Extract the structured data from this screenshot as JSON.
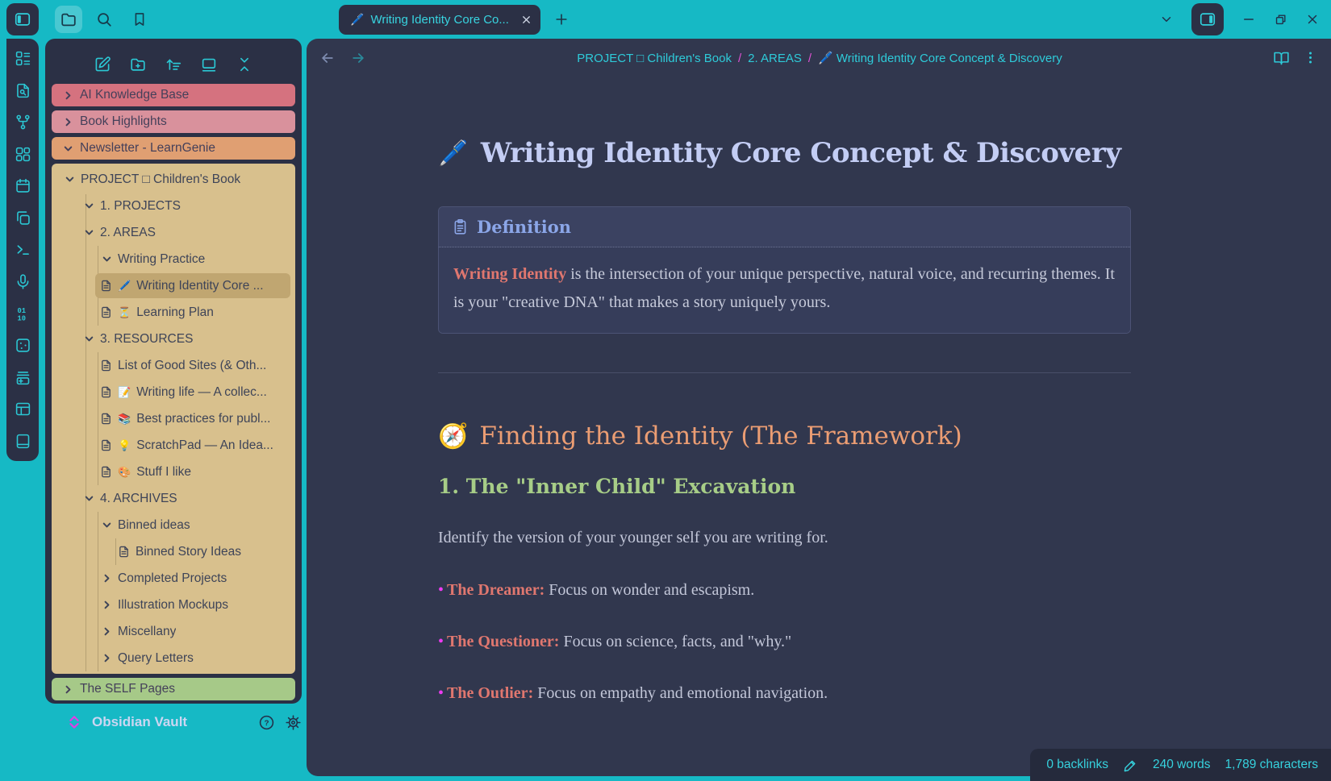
{
  "titlebar": {
    "tab": {
      "emoji": "🖊️",
      "title": "Writing Identity Core Co..."
    },
    "ribbon_icons": [
      "files",
      "search",
      "bookmarks"
    ],
    "window_icons": [
      "tab-list-chevron",
      "right-sidebar-toggle",
      "minimize",
      "restore",
      "close"
    ]
  },
  "rail_icons": [
    "workspace-list",
    "file-search",
    "graph-view",
    "canvas",
    "calendar",
    "duplicate",
    "terminal",
    "audio-recorder",
    "binary",
    "random-note",
    "add-card",
    "workspace-layout",
    "reading-book"
  ],
  "explorer": {
    "toolbar_icons": [
      "new-note",
      "new-folder",
      "sort-ascending",
      "stack-view",
      "collapse-all"
    ],
    "top": [
      {
        "label": "AI Knowledge Base"
      },
      {
        "label": "Book Highlights"
      },
      {
        "label": "Newsletter - LearnGenie"
      }
    ],
    "tree": [
      {
        "label": "PROJECT □ Children's Book"
      },
      {
        "label": "1. PROJECTS"
      },
      {
        "label": "2. AREAS"
      },
      {
        "label": "Writing Practice"
      },
      {
        "emoji": "🖊️",
        "label": "Writing Identity Core ..."
      },
      {
        "emoji": "⏳",
        "label": "Learning Plan"
      },
      {
        "label": "3. RESOURCES"
      },
      {
        "emoji": "",
        "label": "List of Good Sites (& Oth..."
      },
      {
        "emoji": "📝",
        "label": "Writing life — A collec..."
      },
      {
        "emoji": "📚",
        "label": "Best practices for publ..."
      },
      {
        "emoji": "💡",
        "label": "ScratchPad — An Idea..."
      },
      {
        "emoji": "🎨",
        "label": "Stuff I like"
      },
      {
        "label": "4. ARCHIVES"
      },
      {
        "label": "Binned ideas"
      },
      {
        "emoji": "",
        "label": "Binned Story Ideas"
      },
      {
        "label": "Completed Projects"
      },
      {
        "label": "Illustration Mockups"
      },
      {
        "label": "Miscellany"
      },
      {
        "label": "Query Letters"
      }
    ],
    "bottom": [
      {
        "label": "The SELF Pages"
      }
    ]
  },
  "vault": {
    "name": "Obsidian Vault"
  },
  "main": {
    "breadcrumb": [
      "PROJECT □ Children's Book",
      "2. AREAS",
      "🖊️ Writing Identity Core Concept & Discovery"
    ],
    "breadcrumb_separator": "/",
    "title": {
      "emoji": "🖊️",
      "text": "Writing Identity Core Concept & Discovery"
    },
    "callout": {
      "header": "Definition",
      "lead": "Writing Identity",
      "rest": " is the intersection of your unique perspective, natural voice, and recurring themes. It is your \"creative DNA\" that makes a story uniquely yours."
    },
    "h2": {
      "emoji": "🧭",
      "text": "Finding the Identity (The Framework)"
    },
    "h3": "1. The \"Inner Child\" Excavation",
    "paragraph": "Identify the version of your younger self you are writing for.",
    "bullets": [
      {
        "lead": "The Dreamer:",
        "rest": " Focus on wonder and escapism."
      },
      {
        "lead": "The Questioner:",
        "rest": " Focus on science, facts, and \"why.\""
      },
      {
        "lead": "The Outlier:",
        "rest": " Focus on empathy and emotional navigation."
      }
    ]
  },
  "statusbar": {
    "backlinks": "0 backlinks",
    "words": "240 words",
    "characters": "1,789 characters"
  },
  "colors": {
    "accent_teal": "#16b9c5",
    "panel_navy": "#2b3045",
    "pane_navy": "#31374e",
    "folder_red": "#d5727f",
    "folder_pink": "#d9919c",
    "folder_orange": "#e09f72",
    "folder_tan": "#d8c08d",
    "folder_green": "#a6c988",
    "selected_tan": "#c0a671",
    "cyan_text": "#38d4e0",
    "pink_separator": "#e052d4",
    "title_periwinkle": "#c3cdf4",
    "h2_orange": "#eb9d73",
    "h3_green": "#a7cd87",
    "salmon_bold": "#e0776f",
    "bullet_magenta": "#ee3bf2"
  }
}
